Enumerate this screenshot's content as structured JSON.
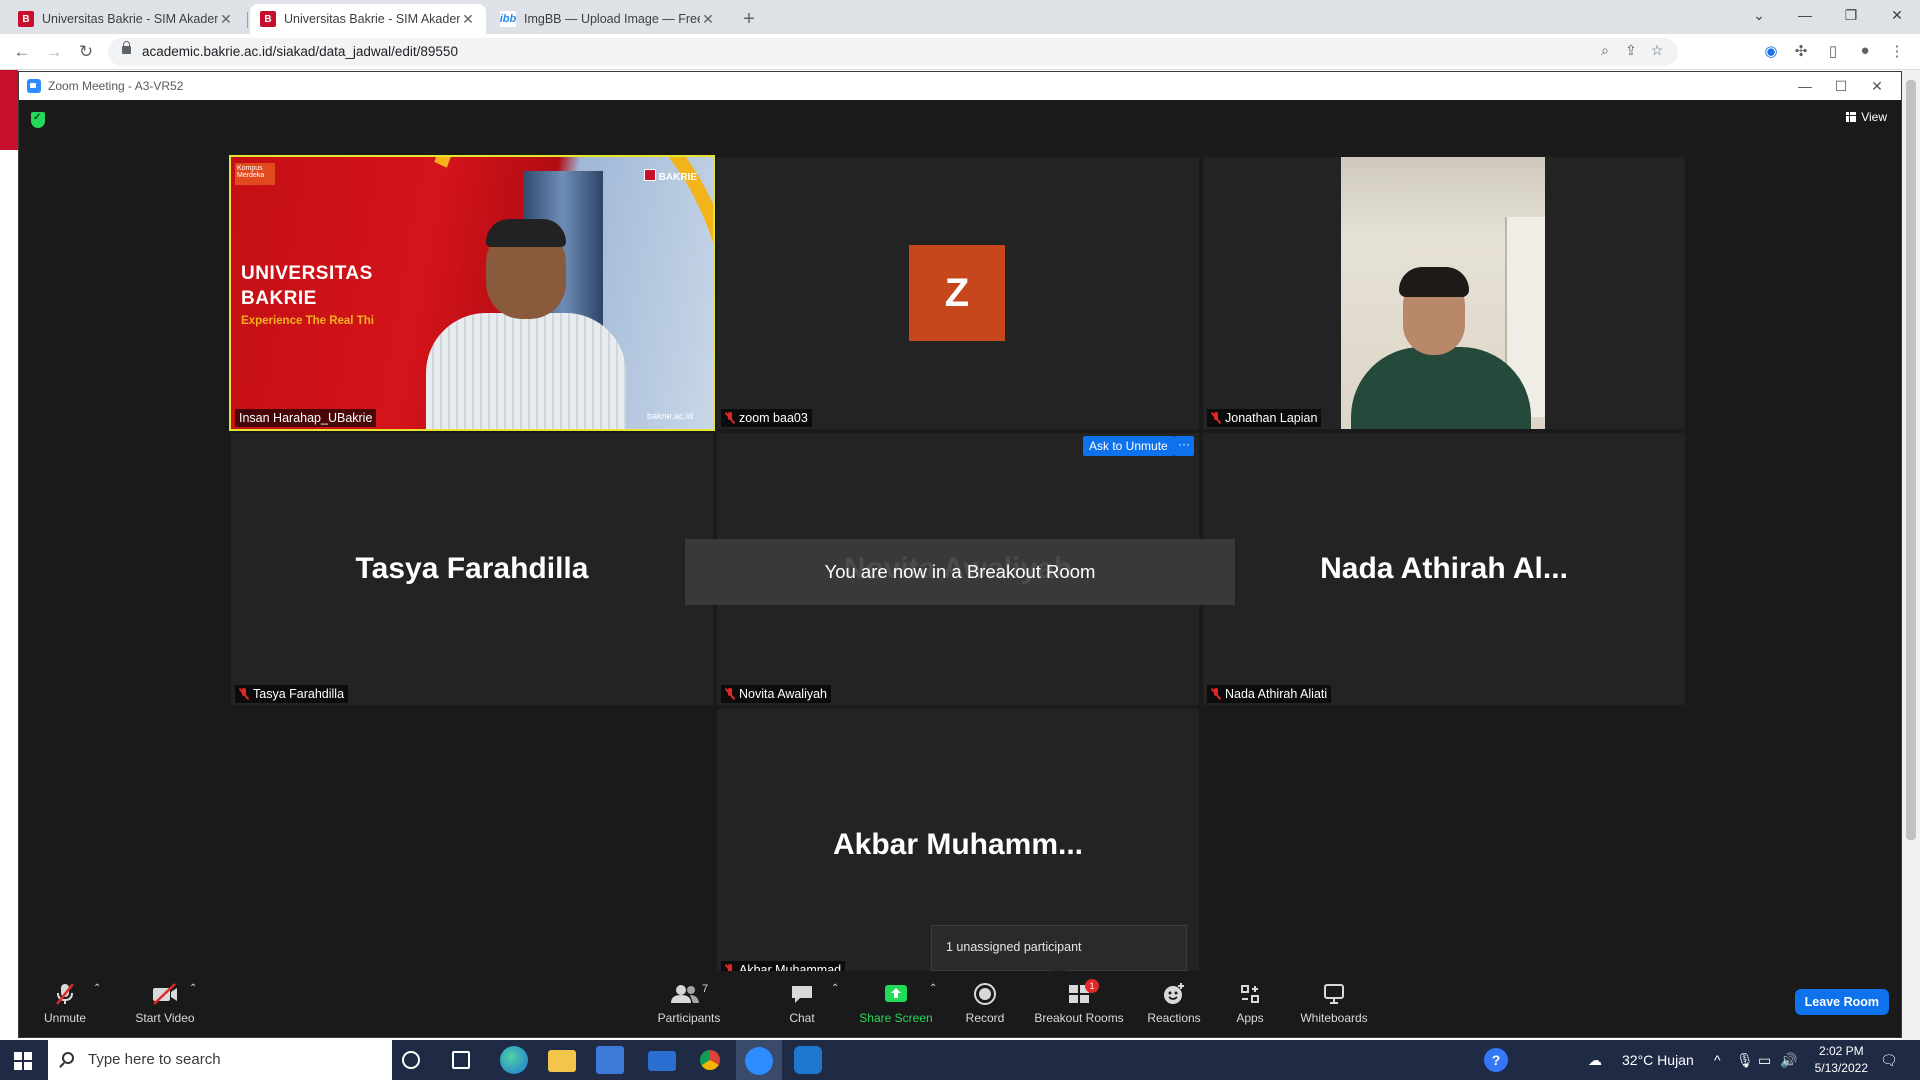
{
  "browser": {
    "tabs": [
      {
        "label": "Universitas Bakrie - SIM Akadem",
        "active": false
      },
      {
        "label": "Universitas Bakrie - SIM Akadem",
        "active": true
      },
      {
        "label": "ImgBB — Upload Image — Free I",
        "active": false
      }
    ],
    "url": "academic.bakrie.ac.id/siakad/data_jadwal/edit/89550"
  },
  "zoom": {
    "window_title": "Zoom Meeting - A3-VR52",
    "view_label": "View",
    "banner_text": "You are now in a Breakout Room",
    "ask_unmute_label": "Ask to Unmute",
    "more_label": "···",
    "unassigned_tooltip": "1 unassigned participant",
    "tiles": [
      {
        "name": "Insan Harahap_UBakrie",
        "video": true,
        "speaking": true
      },
      {
        "name": "zoom baa03",
        "avatar_letter": "Z",
        "muted": true
      },
      {
        "name": "Jonathan Lapian",
        "video": true,
        "muted": true
      },
      {
        "name": "Tasya Farahdilla",
        "display": "Tasya Farahdilla",
        "muted": true
      },
      {
        "name": "Novita Awaliyah",
        "display": "Novita Awaliyah",
        "muted": true
      },
      {
        "name": "Nada Athirah Aliati",
        "display": "Nada Athirah Al...",
        "muted": true
      },
      {
        "name": "Akbar Muhammad",
        "display": "Akbar  Muhamm...",
        "muted": true
      }
    ],
    "speaker_banner": {
      "university": "UNIVERSITAS BAKRIE",
      "university_line1": "UNIVERSITAS",
      "university_line2": "BAKRIE",
      "tagline": "Experience The Real Thi",
      "brand": "BAKRIE",
      "site": "bakrie.ac.id",
      "kompus": "Kompus Merdeka"
    },
    "toolbar": {
      "unmute": "Unmute",
      "start_video": "Start Video",
      "participants": "Participants",
      "participants_count": "7",
      "chat": "Chat",
      "share_screen": "Share Screen",
      "record": "Record",
      "breakout_rooms": "Breakout Rooms",
      "breakout_badge": "1",
      "reactions": "Reactions",
      "apps": "Apps",
      "whiteboards": "Whiteboards",
      "leave": "Leave Room"
    }
  },
  "taskbar": {
    "search_placeholder": "Type here to search",
    "weather": "32°C  Hujan",
    "time": "2:02 PM",
    "date": "5/13/2022"
  },
  "colors": {
    "zoom_blue": "#0e72ed",
    "speaking_outline": "#e6e331",
    "avatar_z": "#c7471c",
    "share_green": "#23d959",
    "mic_off_red": "#e02828"
  }
}
